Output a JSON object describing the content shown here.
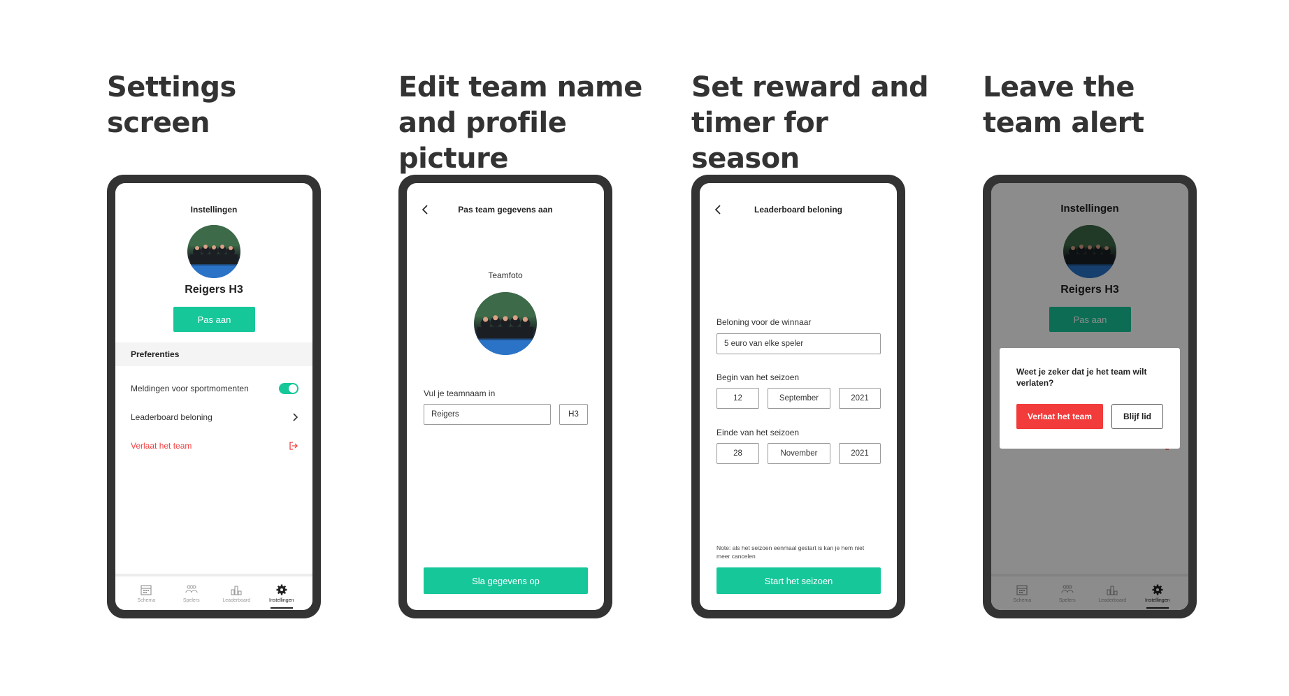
{
  "columns": [
    {
      "title": "Settings screen"
    },
    {
      "title": "Edit team name and profile picture"
    },
    {
      "title": "Set reward and timer for season"
    },
    {
      "title": "Leave the team alert"
    }
  ],
  "settings": {
    "title": "Instellingen",
    "team_name": "Reigers H3",
    "edit_button": "Pas aan",
    "section": "Preferenties",
    "notifications_label": "Meldingen voor sportmomenten",
    "notifications_on": true,
    "leaderboard_label": "Leaderboard beloning",
    "leave_label": "Verlaat het team"
  },
  "tabbar": {
    "items": [
      {
        "label": "Schema",
        "icon": "calendar-icon"
      },
      {
        "label": "Spelers",
        "icon": "players-icon"
      },
      {
        "label": "Leaderboard",
        "icon": "leaderboard-icon"
      },
      {
        "label": "Instellingen",
        "icon": "gear-icon",
        "active": true
      }
    ]
  },
  "edit_team": {
    "title": "Pas team gegevens aan",
    "photo_label": "Teamfoto",
    "name_label": "Vul je teamnaam in",
    "name_value": "Reigers",
    "suffix_value": "H3",
    "save_button": "Sla gegevens op"
  },
  "reward": {
    "title": "Leaderboard beloning",
    "reward_label": "Beloning voor de winnaar",
    "reward_value": "5 euro van elke speler",
    "start_label": "Begin van het seizoen",
    "start_day": "12",
    "start_month": "September",
    "start_year": "2021",
    "end_label": "Einde van het seizoen",
    "end_day": "28",
    "end_month": "November",
    "end_year": "2021",
    "note": "Note: als het seizoen eenmaal gestart is kan je hem niet meer cancelen",
    "start_button": "Start het seizoen"
  },
  "alert": {
    "message": "Weet je zeker dat je het team wilt verlaten?",
    "leave_button": "Verlaat het team",
    "stay_button": "Blijf lid"
  },
  "colors": {
    "accent": "#16c79a",
    "danger": "#f24141",
    "frame": "#333333"
  }
}
